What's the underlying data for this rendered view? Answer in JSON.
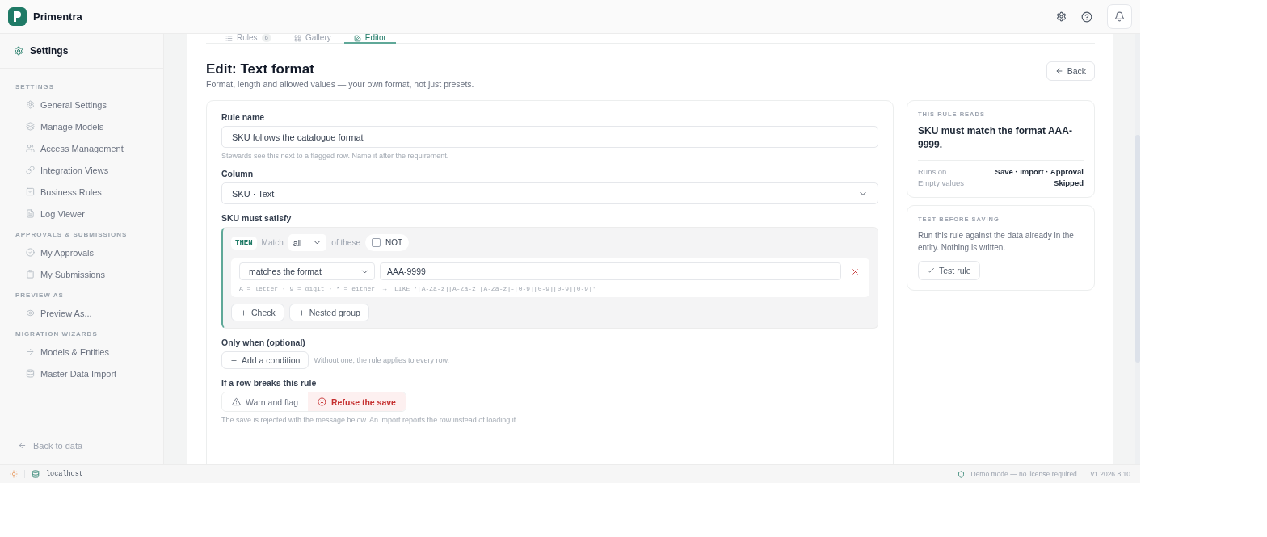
{
  "app": {
    "name": "Primentra"
  },
  "sidebar": {
    "title": "Settings",
    "sections": [
      {
        "heading": "SETTINGS",
        "items": [
          {
            "label": "General Settings"
          },
          {
            "label": "Manage Models"
          },
          {
            "label": "Access Management"
          },
          {
            "label": "Integration Views"
          },
          {
            "label": "Business Rules"
          },
          {
            "label": "Log Viewer"
          }
        ]
      },
      {
        "heading": "APPROVALS & SUBMISSIONS",
        "items": [
          {
            "label": "My Approvals"
          },
          {
            "label": "My Submissions"
          }
        ]
      },
      {
        "heading": "PREVIEW AS",
        "items": [
          {
            "label": "Preview As..."
          }
        ]
      },
      {
        "heading": "MIGRATION WIZARDS",
        "items": [
          {
            "label": "Models & Entities"
          },
          {
            "label": "Master Data Import"
          }
        ]
      }
    ],
    "back": "Back to data"
  },
  "tabs": [
    {
      "label": "Rules",
      "badge": "6",
      "selected": false
    },
    {
      "label": "Gallery",
      "selected": false
    },
    {
      "label": "Editor",
      "selected": true
    }
  ],
  "page": {
    "title": "Edit: Text format",
    "subtitle": "Format, length and allowed values — your own format, not just presets.",
    "back_button": "Back"
  },
  "form": {
    "rule_name": {
      "label": "Rule name",
      "value": "SKU follows the catalogue format",
      "hint": "Stewards see this next to a flagged row. Name it after the requirement."
    },
    "column": {
      "label": "Column",
      "value": "SKU · Text"
    },
    "condition": {
      "label": "SKU must satisfy",
      "tag": "THEN",
      "match_label": "Match",
      "match_value": "all",
      "of_these": "of these",
      "negate": {
        "label": "NOT",
        "checked": false
      },
      "checks": [
        {
          "operator": "matches the format",
          "value": "AAA-9999",
          "hint": "A = letter · 9 = digit · * = either  →  LIKE '[A-Za-z][A-Za-z][A-Za-z]-[0-9][0-9][0-9][0-9]'"
        }
      ],
      "add_buttons": [
        "Check",
        "Nested group"
      ]
    },
    "only_when": {
      "label": "Only when (optional)",
      "button": "Add a condition",
      "hint": "Without one, the rule applies to every row."
    },
    "on_break": {
      "label": "If a row breaks this rule",
      "options": [
        {
          "kind": "warn",
          "label": "Warn and flag",
          "selected": false
        },
        {
          "kind": "refuse",
          "label": "Refuse the save",
          "selected": true
        }
      ],
      "hint": "The save is rejected with the message below. An import reports the row instead of loading it."
    }
  },
  "summary": {
    "heading": "THIS RULE READS",
    "text": "SKU must match the format AAA-9999.",
    "rows": [
      {
        "label": "Runs on",
        "value": "Save · Import · Approval"
      },
      {
        "label": "Empty values",
        "value": "Skipped"
      }
    ]
  },
  "test": {
    "heading": "TEST BEFORE SAVING",
    "text": "Run this rule against the data already in the entity. Nothing is written.",
    "button": "Test rule"
  },
  "status_bar": {
    "host": "localhost",
    "demo": "Demo mode — no license required",
    "version": "v1.2026.8.10"
  }
}
